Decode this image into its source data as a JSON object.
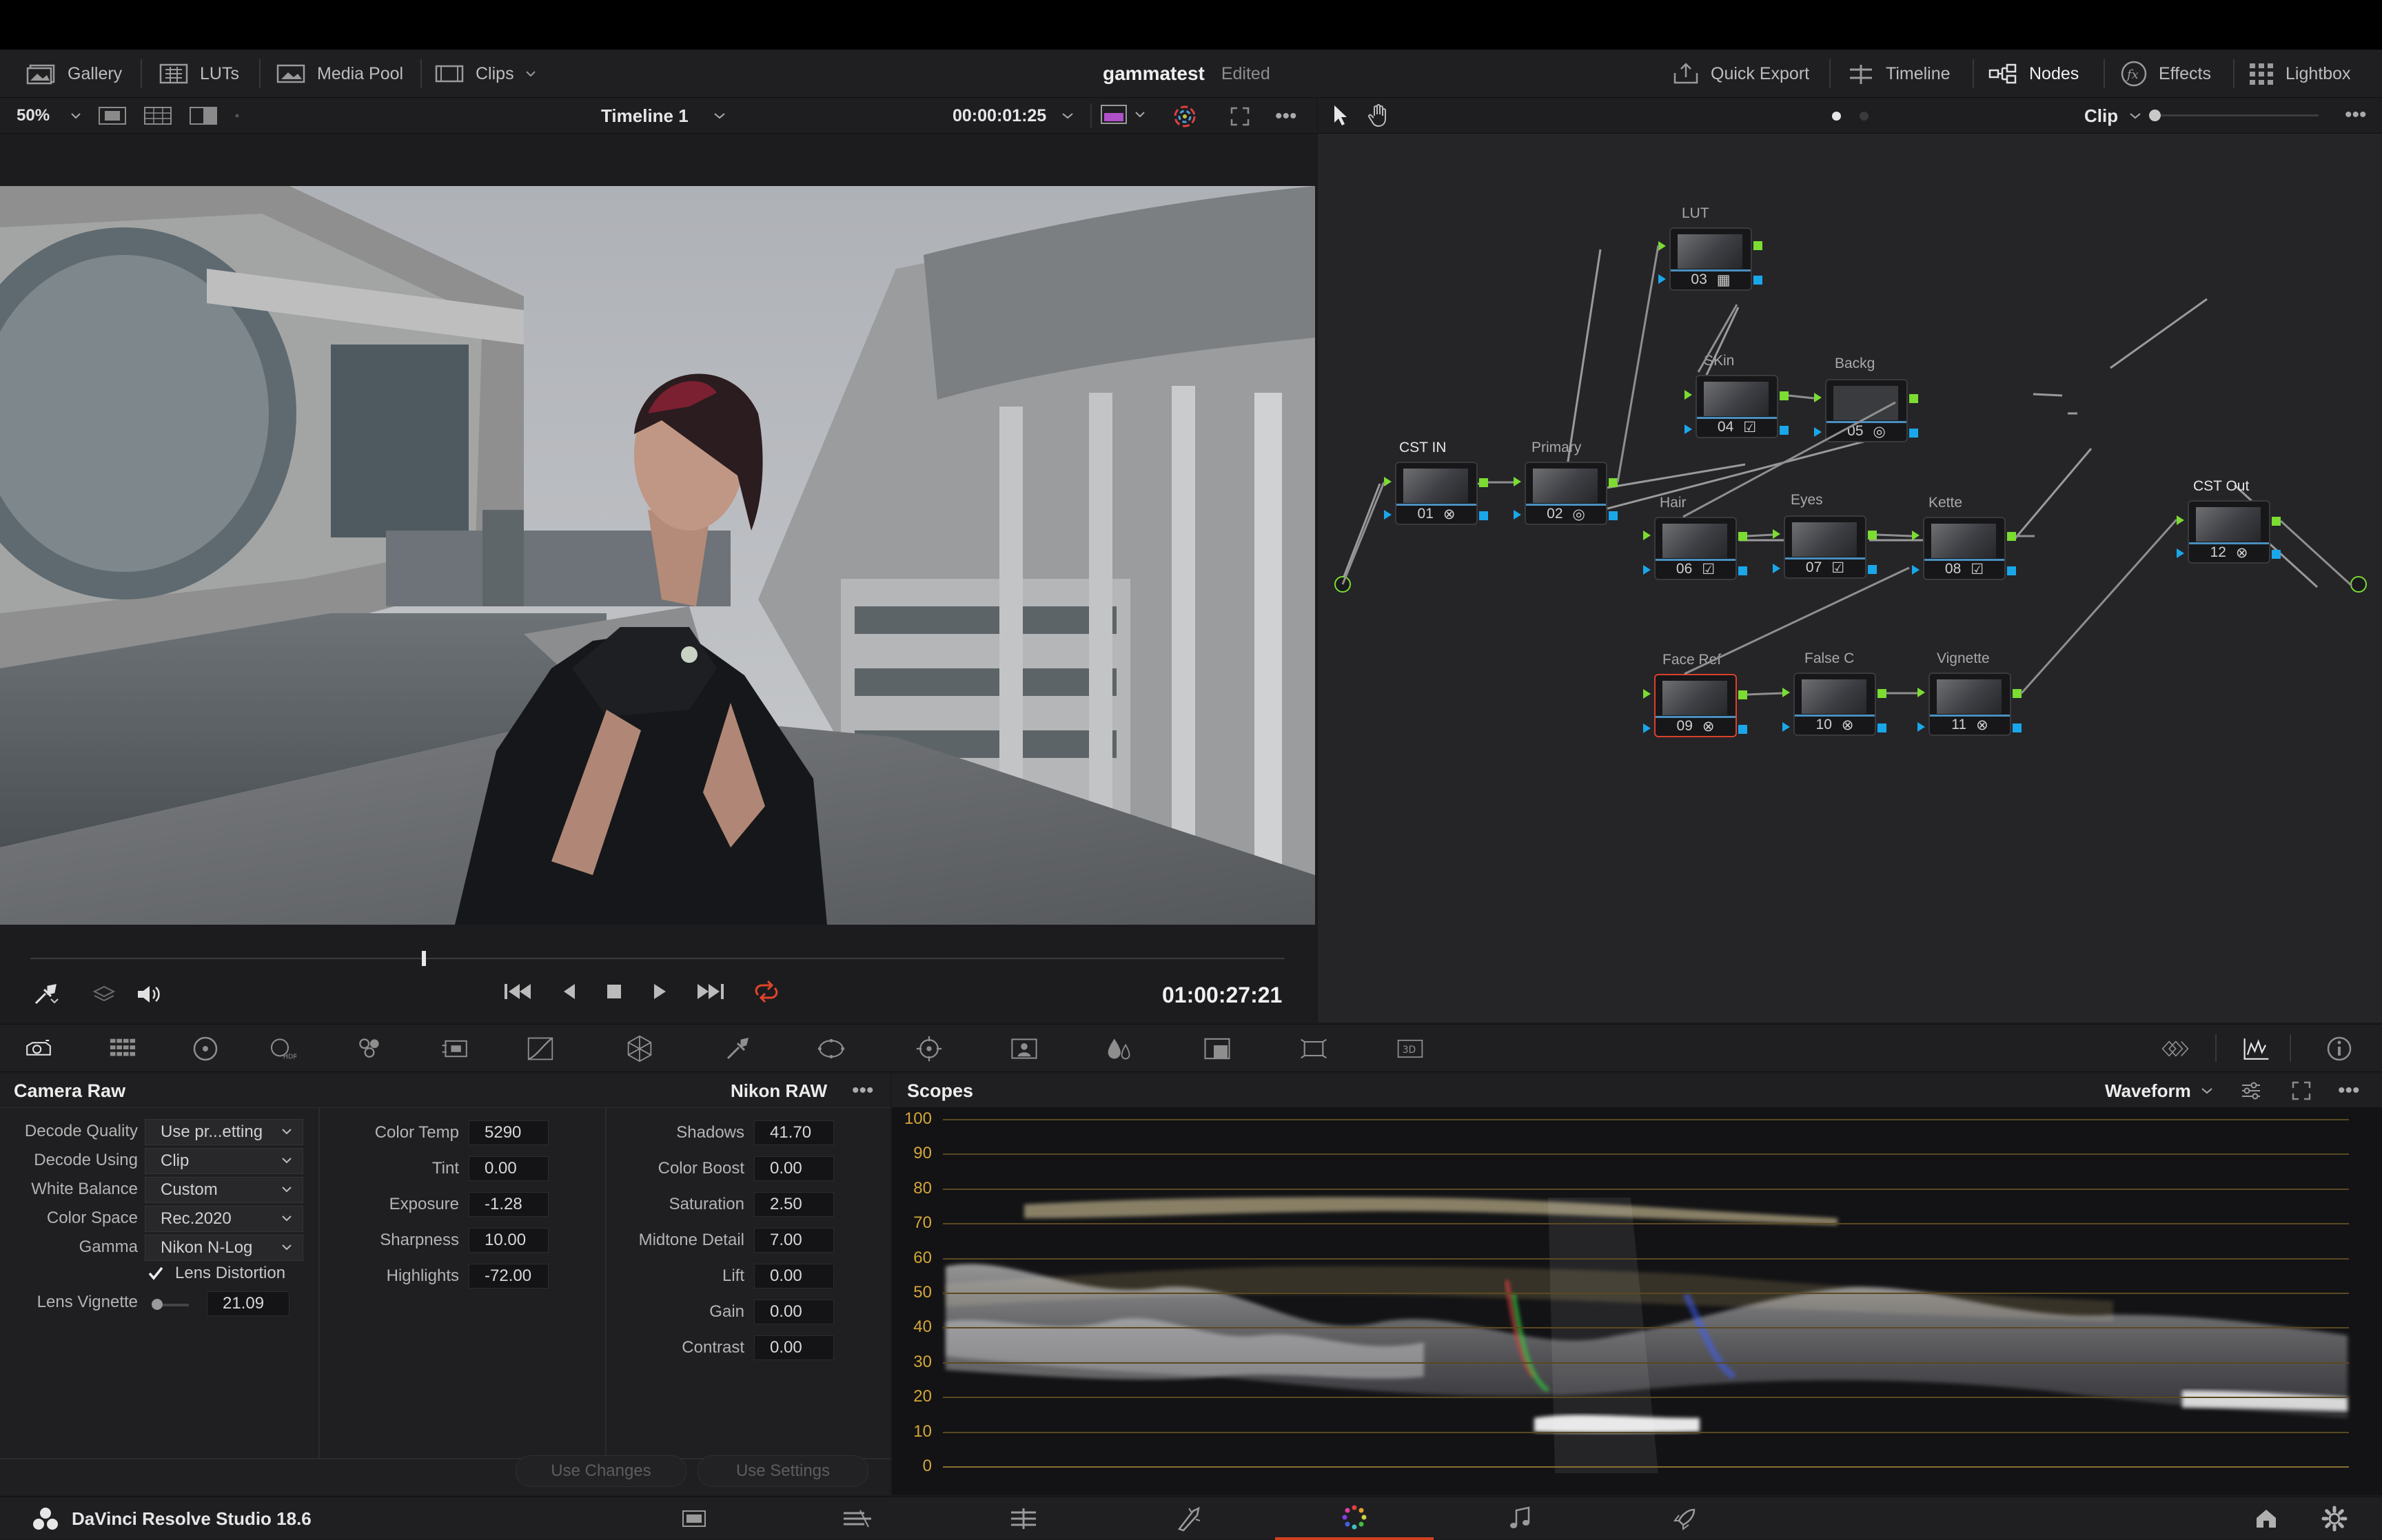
{
  "toolbar": {
    "gallery": "Gallery",
    "luts": "LUTs",
    "media_pool": "Media Pool",
    "clips": "Clips",
    "project_name": "gammatest",
    "project_status": "Edited",
    "quick_export": "Quick Export",
    "timeline": "Timeline",
    "nodes": "Nodes",
    "effects": "Effects",
    "lightbox": "Lightbox"
  },
  "viewer_head": {
    "zoom": "50%",
    "timeline_name": "Timeline 1",
    "timecode_top": "00:00:01:25"
  },
  "nodes_head": {
    "mode": "Clip"
  },
  "transport": {
    "timecode": "01:00:27:21"
  },
  "nodes": [
    {
      "label": "LUT",
      "num": "03"
    },
    {
      "label": "SKin",
      "num": "04"
    },
    {
      "label": "Backg",
      "num": "05"
    },
    {
      "label": "CST IN",
      "num": "01"
    },
    {
      "label": "Primary",
      "num": "02"
    },
    {
      "label": "Hair",
      "num": "06"
    },
    {
      "label": "Eyes",
      "num": "07"
    },
    {
      "label": "Kette",
      "num": "08"
    },
    {
      "label": "CST Out",
      "num": "12"
    },
    {
      "label": "Face Ref",
      "num": "09"
    },
    {
      "label": "False C",
      "num": "10"
    },
    {
      "label": "Vignette",
      "num": "11"
    }
  ],
  "camera_raw": {
    "title": "Camera Raw",
    "camera": "Nikon RAW",
    "decode_quality_label": "Decode Quality",
    "decode_quality_value": "Use pr...etting",
    "decode_using_label": "Decode Using",
    "decode_using_value": "Clip",
    "white_balance_label": "White Balance",
    "white_balance_value": "Custom",
    "color_space_label": "Color Space",
    "color_space_value": "Rec.2020",
    "gamma_label": "Gamma",
    "gamma_value": "Nikon N-Log",
    "lens_distortion_label": "Lens Distortion",
    "lens_vignette_label": "Lens Vignette",
    "lens_vignette_value": "21.09",
    "color_temp_label": "Color Temp",
    "color_temp_value": "5290",
    "tint_label": "Tint",
    "tint_value": "0.00",
    "exposure_label": "Exposure",
    "exposure_value": "-1.28",
    "sharpness_label": "Sharpness",
    "sharpness_value": "10.00",
    "highlights_label": "Highlights",
    "highlights_value": "-72.00",
    "shadows_label": "Shadows",
    "shadows_value": "41.70",
    "color_boost_label": "Color Boost",
    "color_boost_value": "0.00",
    "saturation_label": "Saturation",
    "saturation_value": "2.50",
    "midtone_detail_label": "Midtone Detail",
    "midtone_detail_value": "7.00",
    "lift_label": "Lift",
    "lift_value": "0.00",
    "gain_label": "Gain",
    "gain_value": "0.00",
    "contrast_label": "Contrast",
    "contrast_value": "0.00",
    "use_changes": "Use Changes",
    "use_settings": "Use Settings"
  },
  "scopes": {
    "title": "Scopes",
    "mode": "Waveform",
    "scale": [
      "100",
      "90",
      "80",
      "70",
      "60",
      "50",
      "40",
      "30",
      "20",
      "10",
      "0"
    ]
  },
  "app": {
    "name": "DaVinci Resolve Studio 18.6"
  },
  "colors": {
    "accent_red": "#d2401f",
    "node_green": "#7bdc32",
    "node_blue": "#1aa7ea",
    "scope_grid": "#d4a63a",
    "selected_node_border": "#d9402b"
  }
}
